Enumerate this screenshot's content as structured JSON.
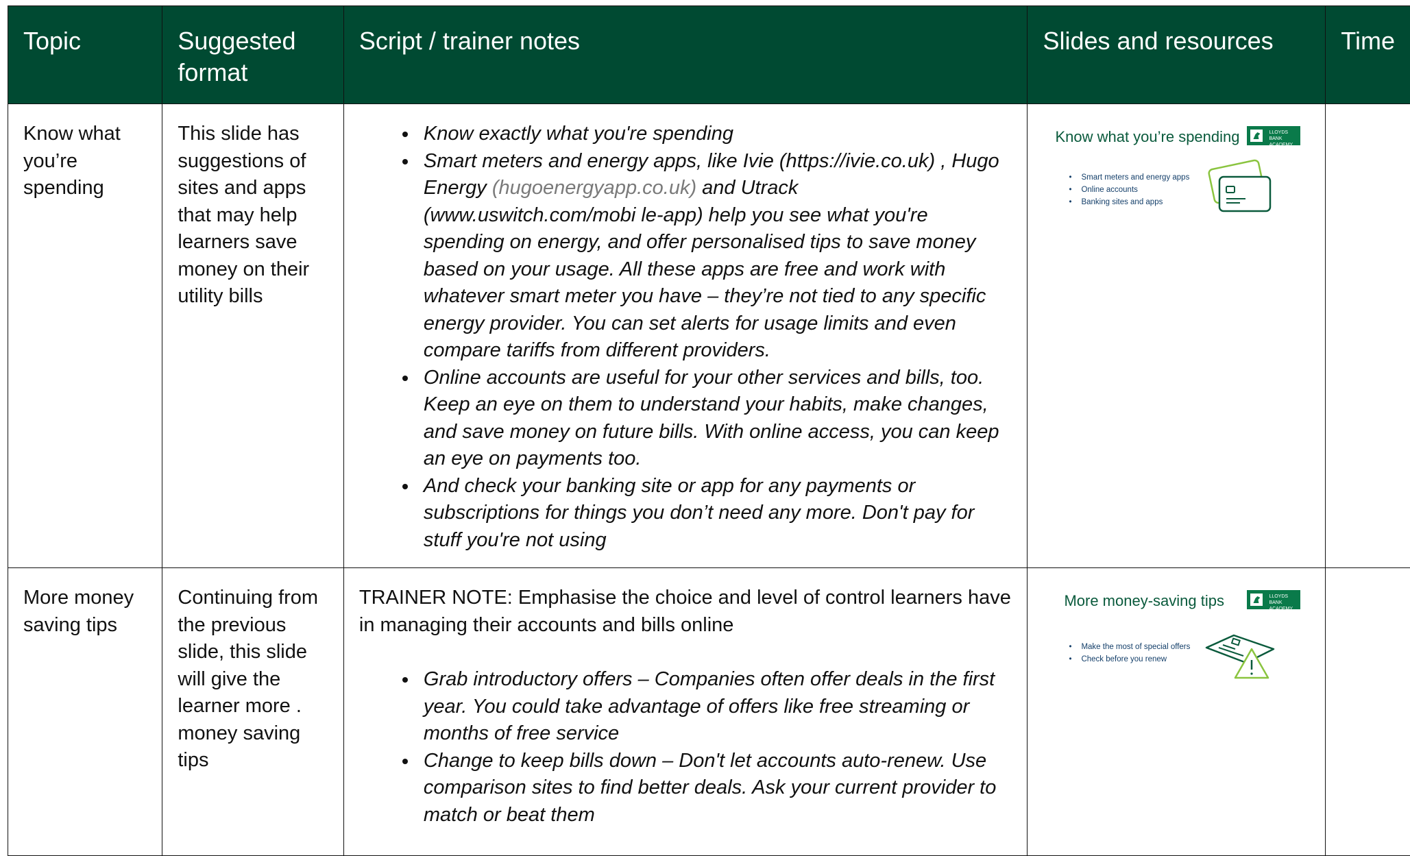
{
  "headers": {
    "topic": "Topic",
    "format": "Suggested format",
    "script": "Script / trainer notes",
    "slides": "Slides and resources",
    "time": "Time"
  },
  "rows": [
    {
      "topic": "Know what you’re spending",
      "format": "This slide has suggestions of sites and apps that may help learners save money on their utility bills",
      "bullets": {
        "b1": "Know exactly what you're spending",
        "b2_a": "Smart meters and energy apps, like Ivie (https://ivie.co.uk) , Hugo Energy ",
        "b2_link": "(hugoenergyapp.co.uk)",
        "b2_b": " and Utrack (www.uswitch.com/mobi le-app) help you see what you're spending on energy, and offer personalised tips to save money based on your usage. All these apps are free and work with whatever smart meter you have – they’re not tied to any specific energy provider. You can set alerts for usage limits and even compare tariffs from different providers.",
        "b3": "Online accounts are useful for your other services and bills, too. Keep an eye on them to understand your habits, make changes, and save money on future bills. With online access, you can keep an eye on payments too.",
        "b4": "And check your banking site or app for any payments or subscriptions for things you don’t need any more. Don't pay for stuff you're not using"
      },
      "slide": {
        "title": "Know what you’re spending",
        "logo": "LLOYDS BANK ACADEMY",
        "items": [
          "Smart meters and energy apps",
          "Online accounts",
          "Banking sites and apps"
        ],
        "icon": "cards-icon"
      },
      "time": ""
    },
    {
      "topic": "More money saving tips",
      "format": "Continuing from the previous slide, this slide will give the learner more . money saving tips",
      "note": "TRAINER NOTE: Emphasise the choice and level of control learners have in managing their accounts and bills online",
      "bullets": {
        "b1": "Grab introductory offers – Companies often offer deals in the first year. You could take advantage of offers like free streaming or months of free service",
        "b2": "Change to keep bills down – Don't let accounts auto-renew. Use comparison sites to find better deals. Ask your current provider to match or beat them"
      },
      "slide": {
        "title": "More money-saving tips",
        "logo": "LLOYDS BANK ACADEMY",
        "items": [
          "Make the most of special offers",
          "Check before you renew"
        ],
        "icon": "card-warning-icon"
      },
      "time": ""
    }
  ],
  "colors": {
    "header_bg": "#004a32",
    "slide_green": "#0a5a3c",
    "logo_green": "#0a7a4a",
    "icon_green": "#8ac43f"
  }
}
